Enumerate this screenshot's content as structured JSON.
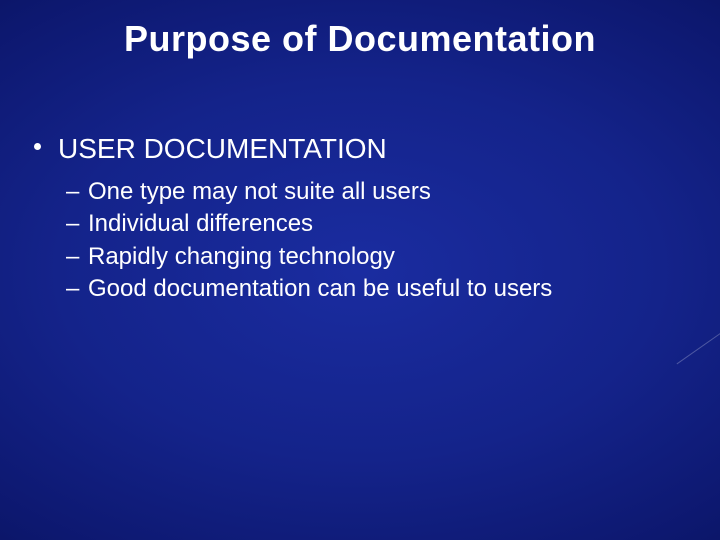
{
  "slide": {
    "title": "Purpose of Documentation",
    "heading": "USER DOCUMENTATION",
    "items": [
      "One type may not suite all users",
      "Individual differences",
      "Rapidly changing technology",
      "Good documentation can be useful to users"
    ]
  }
}
